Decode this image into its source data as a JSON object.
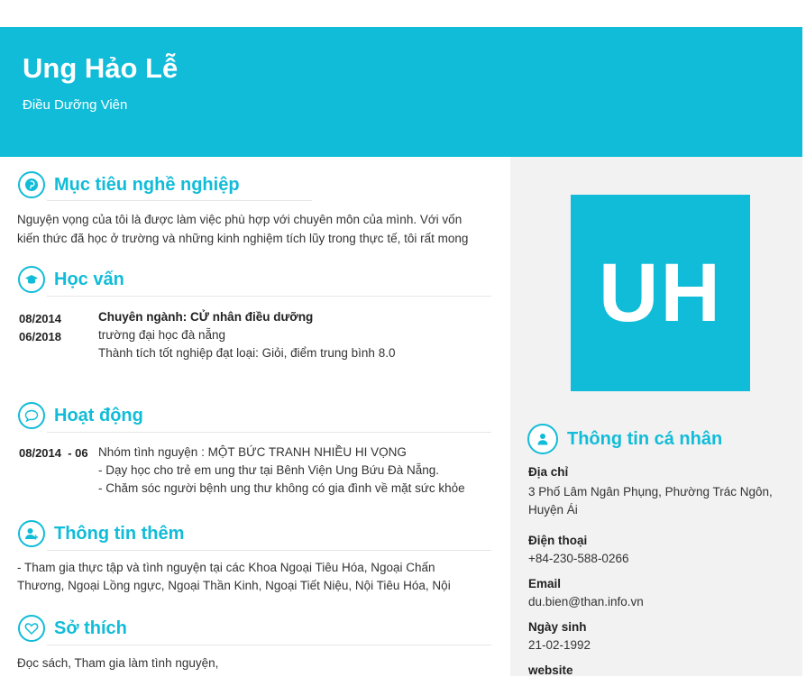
{
  "header": {
    "name": "Ung Hảo Lễ",
    "job_title": "Điều Dưỡng Viên"
  },
  "avatar": {
    "initials": "UH"
  },
  "colors": {
    "accent": "#11bcd8",
    "sidebar_bg": "#f2f2f2"
  },
  "objective": {
    "title": "Mục tiêu nghề nghiệp",
    "icon": "pinterest-icon",
    "lines": [
      "Nguyện vọng của tôi là được làm việc phù hợp với chuyên môn của mình. Với vốn",
      "kiến thức đã học ở trường và những kinh nghiệm tích lũy trong thực tế, tôi rất mong"
    ]
  },
  "education": {
    "title": "Học vấn",
    "icon": "graduation-cap-icon",
    "date_start": "08/2014",
    "date_end": "06/2018",
    "major": "Chuyên ngành: CỬ nhân điều dưỡng",
    "school": "trường đại học đà nẵng",
    "achievement": "Thành tích tốt nghiệp đạt loại: Giỏi, điểm trung bình 8.0"
  },
  "activities": {
    "title": "Hoạt động",
    "icon": "chat-bubble-icon",
    "date": "08/2014",
    "date_suffix": "- 06",
    "lines": [
      "Nhóm tình nguyện : MỘT BỨC TRANH NHIỀU HI VỌNG",
      "- Dạy học cho trẻ em ung thư tại Bênh Viện Ung Bứu Đà Nẵng.",
      "- Chăm sóc người bệnh ung thư không có gia đình về mặt sức khỏe"
    ]
  },
  "additional": {
    "title": "Thông tin thêm",
    "icon": "user-plus-icon",
    "lines": [
      "- Tham gia thực tập và tình nguyện tại các Khoa Ngoại Tiêu Hóa, Ngoại Chấn",
      "Thương, Ngoại Lồng ngực, Ngoại Thần Kinh, Ngoại Tiết Niệu, Nội Tiêu Hóa, Nội"
    ]
  },
  "hobbies": {
    "title": "Sở thích",
    "icon": "heart-icon",
    "text": "Đọc sách, Tham gia làm tình nguyện,"
  },
  "personal": {
    "title": "Thông tin cá nhân",
    "icon": "user-icon",
    "address_label": "Địa chỉ",
    "address_lines": [
      "3 Phố Lâm Ngân Phụng, Phường Trác Ngôn,",
      "Huyện Ái"
    ],
    "phone_label": "Điện thoại",
    "phone": "+84-230-588-0266",
    "email_label": "Email",
    "email": "du.bien@than.info.vn",
    "dob_label": "Ngày sinh",
    "dob": "21-02-1992",
    "website_label": "website"
  }
}
